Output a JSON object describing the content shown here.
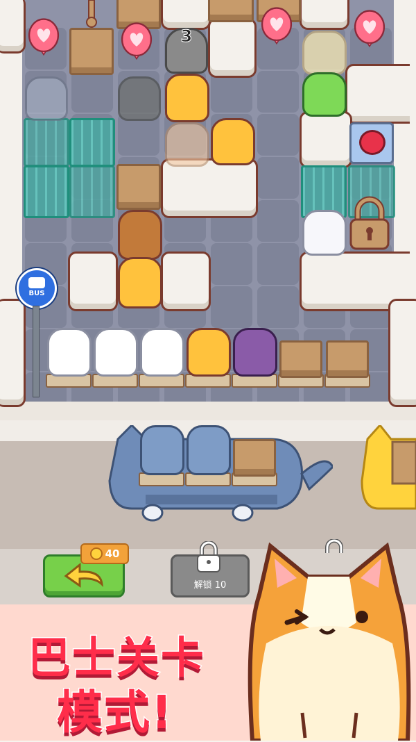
{
  "level": {
    "countdown": "3",
    "bus_stop_label": "BUS",
    "waiting_cats": [
      "white",
      "white",
      "white",
      "orange",
      "purple"
    ],
    "empty_slots": 2
  },
  "bus": {
    "passengers": [
      "gray-tabby",
      "gray-tabby"
    ],
    "empty_seats": 1
  },
  "controls": {
    "undo_cost": "40",
    "unlock_label": "解锁 10"
  },
  "promo": {
    "line1": "巴士关卡",
    "line2": "模式!"
  },
  "colors": {
    "board": "#8f93a8",
    "wall_outline": "#7a3b2e",
    "accent_red": "#ff2d4a",
    "undo_green": "#77d04a",
    "coin_orange": "#f2a23a"
  }
}
